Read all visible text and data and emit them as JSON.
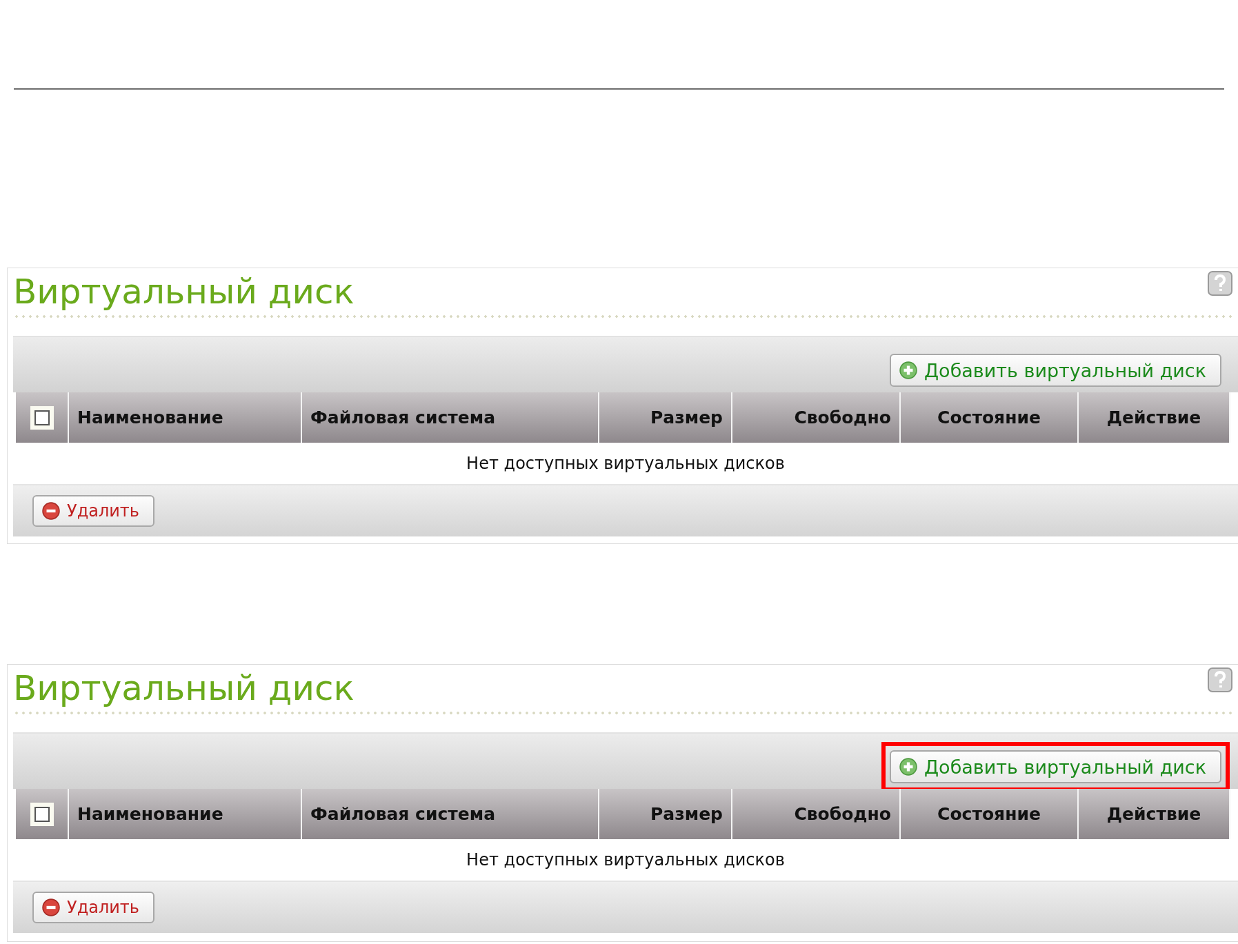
{
  "panels": [
    {
      "title": "Виртуальный диск",
      "add_button": "Добавить виртуальный диск",
      "highlighted": false,
      "select_all_checked": false,
      "columns": [
        "Наименование",
        "Файловая система",
        "Размер",
        "Свободно",
        "Состояние",
        "Действие"
      ],
      "empty_message": "Нет доступных виртуальных дисков",
      "delete_button": "Удалить"
    },
    {
      "title": "Виртуальный диск",
      "add_button": "Добавить виртуальный диск",
      "highlighted": true,
      "select_all_checked": false,
      "columns": [
        "Наименование",
        "Файловая система",
        "Размер",
        "Свободно",
        "Состояние",
        "Действие"
      ],
      "empty_message": "Нет доступных виртуальных дисков",
      "delete_button": "Удалить"
    }
  ]
}
